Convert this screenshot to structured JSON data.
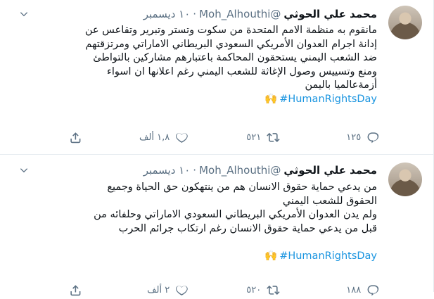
{
  "tweets": [
    {
      "name": "محمد علي الحوثي",
      "handle": "@Moh_Alhouthi",
      "time": "١٠ ديسمبر",
      "lines": [
        "مانقوم به منظمة الامم المتحدة من سكوت وتستر وتبرير وتقاعس عن",
        "إدانة اجرام العدوان الأمريكي السعودي البريطاني الاماراتي ومرتزقتهم",
        "ضد الشعب اليمني يستحقون المحاكمة باعتبارهم مشاركين بالتواطئ",
        "ومنع وتسييس وصول الإغاثة للشعب اليمني رغم اعلانها ان اسواء",
        "أزمةعالميا باليمن"
      ],
      "hashtag": "#HumanRightsDay",
      "emoji": "🙌",
      "reply_count": "١٢٥",
      "retweet_count": "٥٢١",
      "like_count": "١,٨ ألف"
    },
    {
      "name": "محمد علي الحوثي",
      "handle": "@Moh_Alhouthi",
      "time": "١٠ ديسمبر",
      "lines": [
        "من يدعي حماية حقوق الانسان هم من ينتهكون حق الحياة وجميع",
        "الحقوق للشعب اليمني",
        "ولم يدن العدوان الأمريكي البريطاني السعودي الاماراتي وحلفائه من",
        "قبل من يدعي حماية حقوق الانسان رغم ارتكاب جرائم الحرب"
      ],
      "hashtag": "#HumanRightsDay",
      "emoji": "🙌",
      "reply_count": "١٨٨",
      "retweet_count": "٥٢٠",
      "like_count": "٢ ألف"
    }
  ],
  "icons": {
    "reply": "reply-icon",
    "retweet": "retweet-icon",
    "like": "heart-icon",
    "share": "share-icon",
    "more": "chevron-down-icon"
  },
  "colors": {
    "text": "#0f1419",
    "secondary": "#5b7083",
    "link": "#1b95e0",
    "border": "#e6ecf0"
  }
}
